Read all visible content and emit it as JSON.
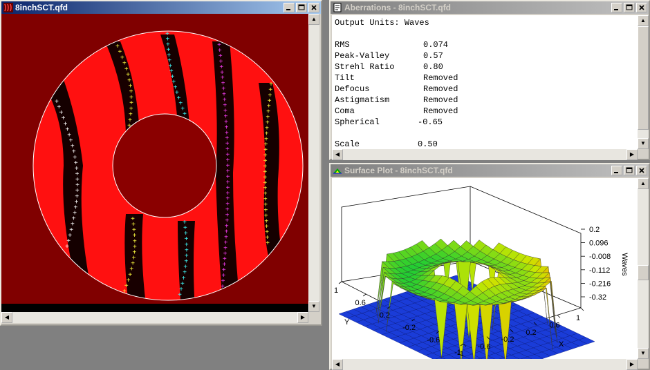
{
  "interferogram_window": {
    "title": "8inchSCT.qfd",
    "icon": "fringe-icon"
  },
  "aberrations_window": {
    "title": "Aberrations - 8inchSCT.qfd",
    "icon": "document-icon",
    "header_line": "Output Units: Waves",
    "rows": [
      {
        "label": "RMS",
        "value": "0.074"
      },
      {
        "label": "Peak-Valley",
        "value": "0.57"
      },
      {
        "label": "Strehl Ratio",
        "value": "0.80"
      },
      {
        "label": "Tilt",
        "value": "Removed"
      },
      {
        "label": "Defocus",
        "value": "Removed"
      },
      {
        "label": "Astigmatism",
        "value": "Removed"
      },
      {
        "label": "Coma",
        "value": "Removed"
      },
      {
        "label": "Spherical",
        "value": "-0.65"
      }
    ],
    "scale_label": "Scale",
    "scale_value": "0.50"
  },
  "surface_window": {
    "title": "Surface Plot - 8inchSCT.qfd",
    "icon": "surface-plot-icon",
    "z_label": "Waves",
    "z_ticks": [
      "0.2",
      "0.096",
      "-0.008",
      "-0.112",
      "-0.216",
      "-0.32"
    ],
    "x_label": "X",
    "x_ticks": [
      "1",
      "0.6",
      "0.2",
      "-0.2",
      "-0.6",
      "-1"
    ],
    "y_label": "Y",
    "y_ticks": [
      "1",
      "0.6",
      "0.2",
      "-0.2",
      "-0.6",
      "-1"
    ]
  },
  "colors": {
    "titlebar_active": "#0a246a",
    "fringe_background": "#800000",
    "fringe_red": "#ff1010",
    "marker_white": "#ffffff",
    "marker_yellow": "#ffff40",
    "marker_cyan": "#40ffff",
    "marker_magenta": "#ff40ff"
  }
}
